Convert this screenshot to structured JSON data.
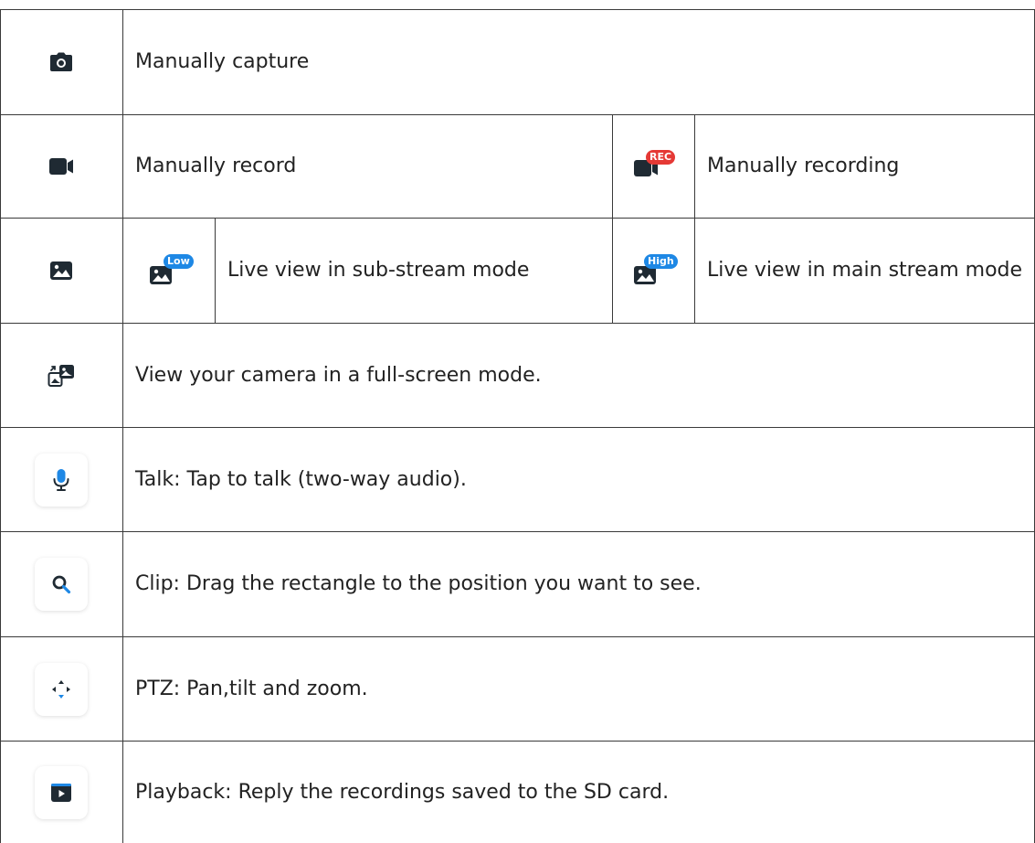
{
  "rows": [
    {
      "icon": "camera-icon",
      "text": "Manually capture"
    },
    {
      "icon": "video-record-icon",
      "text": "Manually record",
      "sub": {
        "icon": "recording-icon",
        "badge": "REC",
        "text": "Manually recording"
      }
    },
    {
      "icon": "image-icon",
      "sub_low": {
        "icon": "substream-low-icon",
        "badge": "Low",
        "text": "Live view in sub-stream mode"
      },
      "sub_high": {
        "icon": "mainstream-high-icon",
        "badge": "High",
        "text": "Live view in main stream mode"
      }
    },
    {
      "icon": "fullscreen-icon",
      "text": "View your camera in a full-screen mode."
    },
    {
      "icon": "microphone-icon",
      "text": "Talk: Tap to talk (two-way audio)."
    },
    {
      "icon": "zoom-search-icon",
      "text": "Clip: Drag the rectangle to the position you want to see."
    },
    {
      "icon": "ptz-arrows-icon",
      "text": "PTZ: Pan,tilt and zoom."
    },
    {
      "icon": "playback-icon",
      "text": "Playback: Reply the recordings saved to the SD card."
    }
  ],
  "colors": {
    "border": "#3a3a3a",
    "icon_dark": "#1f2a33",
    "accent_blue": "#1e88e5",
    "rec_red": "#e53935"
  }
}
